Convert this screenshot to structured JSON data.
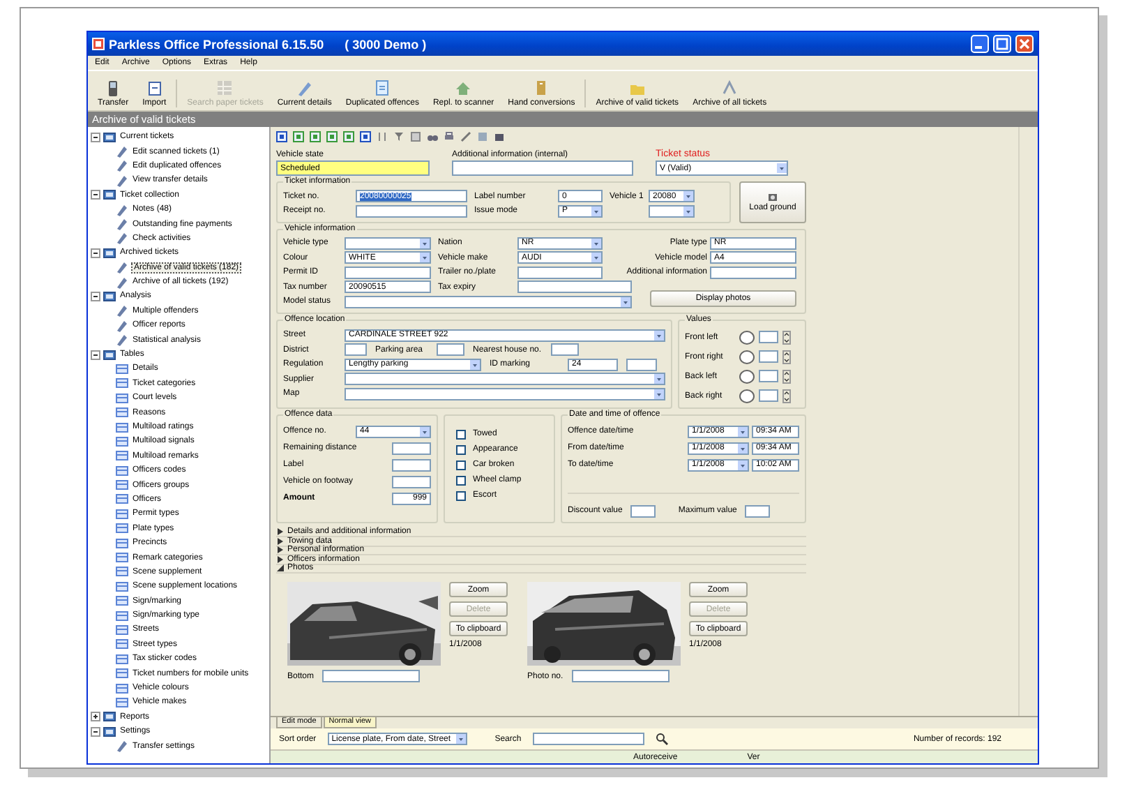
{
  "window": {
    "title": "Parkless Office Professional 6.15.50",
    "edition": "( 3000 Demo )"
  },
  "menu": [
    "Edit",
    "Archive",
    "Options",
    "Extras",
    "Help"
  ],
  "toolbar": [
    {
      "label": "Transfer",
      "disabled": false
    },
    {
      "label": "Import",
      "disabled": false
    },
    {
      "label": "Search paper tickets",
      "disabled": true
    },
    {
      "label": "Current details",
      "disabled": false
    },
    {
      "label": "Duplicated offences",
      "disabled": false
    },
    {
      "label": "Repl. to scanner",
      "disabled": false
    },
    {
      "label": "Hand conversions",
      "disabled": false
    },
    {
      "label": "Archive of valid tickets",
      "disabled": false
    },
    {
      "label": "Archive of all tickets",
      "disabled": false
    }
  ],
  "view_header": "Archive of valid tickets",
  "tree": [
    {
      "label": "Current tickets",
      "expanded": true,
      "selected": false,
      "children": [
        {
          "label": "Edit scanned tickets (1)",
          "selected": false
        },
        {
          "label": "Edit duplicated offences",
          "selected": false
        },
        {
          "label": "View transfer details",
          "selected": false
        }
      ]
    },
    {
      "label": "Ticket collection",
      "expanded": true,
      "selected": false,
      "children": [
        {
          "label": "Notes (48)",
          "selected": false
        },
        {
          "label": "Outstanding fine payments",
          "selected": false
        },
        {
          "label": "Check activities",
          "selected": false
        }
      ]
    },
    {
      "label": "Archived tickets",
      "expanded": true,
      "selected": false,
      "children": [
        {
          "label": "Archive of valid tickets (182)",
          "selected": true
        },
        {
          "label": "Archive of all tickets (192)",
          "selected": false
        }
      ]
    },
    {
      "label": "Analysis",
      "expanded": true,
      "selected": false,
      "children": [
        {
          "label": "Multiple offenders",
          "selected": false
        },
        {
          "label": "Officer reports",
          "selected": false
        },
        {
          "label": "Statistical analysis",
          "selected": false
        }
      ]
    },
    {
      "label": "Tables",
      "expanded": true,
      "selected": false,
      "children": [
        {
          "label": "Details",
          "selected": false
        },
        {
          "label": "Ticket categories",
          "selected": false
        },
        {
          "label": "Court levels",
          "selected": false
        },
        {
          "label": "Reasons",
          "selected": false
        },
        {
          "label": "Multiload ratings",
          "selected": false
        },
        {
          "label": "Multiload signals",
          "selected": false
        },
        {
          "label": "Multiload remarks",
          "selected": false
        },
        {
          "label": "Officers codes",
          "selected": false
        },
        {
          "label": "Officers groups",
          "selected": false
        },
        {
          "label": "Officers",
          "selected": false
        },
        {
          "label": "Permit types",
          "selected": false
        },
        {
          "label": "Plate types",
          "selected": false
        },
        {
          "label": "Precincts",
          "selected": false
        },
        {
          "label": "Remark categories",
          "selected": false
        },
        {
          "label": "Scene supplement",
          "selected": false
        },
        {
          "label": "Scene supplement locations",
          "selected": false
        },
        {
          "label": "Sign/marking",
          "selected": false
        },
        {
          "label": "Sign/marking type",
          "selected": false
        },
        {
          "label": "Streets",
          "selected": false
        },
        {
          "label": "Street types",
          "selected": false
        },
        {
          "label": "Tax sticker codes",
          "selected": false
        },
        {
          "label": "Ticket numbers for mobile units",
          "selected": false
        },
        {
          "label": "Vehicle colours",
          "selected": false
        },
        {
          "label": "Vehicle makes",
          "selected": false
        }
      ]
    },
    {
      "label": "Reports",
      "expanded": false,
      "selected": false
    },
    {
      "label": "Settings",
      "expanded": true,
      "selected": false,
      "children": [
        {
          "label": "Transfer settings",
          "selected": false
        }
      ]
    }
  ],
  "form": {
    "top": [
      {
        "label": "Vehicle state",
        "kind": "text",
        "value": "Scheduled",
        "required": true
      },
      {
        "label": "Additional information (internal)",
        "kind": "text"
      },
      {
        "label": "Ticket status",
        "kind": "select",
        "value": "V (Valid)",
        "alert": true
      }
    ],
    "ticket_information": {
      "title": "Ticket information",
      "rows": [
        [
          {
            "label": "Ticket no.",
            "kind": "text",
            "value": "20080000025",
            "highlighted": true
          },
          {
            "label": "Label number",
            "kind": "text",
            "value": "0"
          },
          {
            "label": "Vehicle 1",
            "kind": "select",
            "value": "20080"
          }
        ],
        [
          {
            "label": "Receipt no.",
            "kind": "text"
          },
          {
            "label": "Issue mode",
            "kind": "select",
            "value": "P"
          },
          {
            "kind": "select"
          }
        ]
      ],
      "button": "Load ground"
    },
    "vehicle_information": {
      "title": "Vehicle information",
      "rows": [
        [
          {
            "label": "Vehicle type",
            "kind": "select"
          },
          {
            "label": "Nation",
            "kind": "select",
            "value": "NR"
          },
          {
            "label": "Plate type",
            "kind": "text",
            "value": "NR"
          }
        ],
        [
          {
            "label": "Colour",
            "kind": "select",
            "value": "WHITE"
          },
          {
            "label": "Vehicle make",
            "kind": "select",
            "value": "AUDI"
          },
          {
            "label": "Vehicle model",
            "kind": "text",
            "value": "A4"
          }
        ],
        [
          {
            "label": "Permit ID",
            "kind": "text"
          },
          {
            "label": "Trailer no./plate",
            "kind": "text"
          },
          {
            "label": "Additional information",
            "kind": "text"
          }
        ],
        [
          {
            "label": "Tax number",
            "kind": "text",
            "value": "20090515"
          },
          {
            "label": "Tax expiry",
            "kind": "text"
          }
        ],
        [
          {
            "label": "Model status",
            "kind": "select"
          }
        ]
      ],
      "button": "Display photos"
    },
    "offence_location": {
      "title": "Offence location",
      "fields": [
        {
          "label": "Street",
          "kind": "select",
          "value": "CARDINALE STREET 922"
        },
        {
          "label": "District",
          "kind": "text"
        },
        {
          "label": "Parking area",
          "kind": "text"
        },
        {
          "label": "Nearest house no.",
          "kind": "text"
        },
        {
          "label": "Regulation",
          "kind": "select",
          "value": "Lengthy parking"
        },
        {
          "label": "ID marking",
          "kind": "text",
          "value": "24"
        },
        {
          "kind": "text"
        },
        {
          "label": "Supplier",
          "kind": "select"
        },
        {
          "label": "Map",
          "kind": "select"
        }
      ]
    },
    "values": {
      "title": "Values",
      "rows": [
        {
          "label": "Front left"
        },
        {
          "label": "Front right"
        },
        {
          "label": "Back left"
        },
        {
          "label": "Back right"
        }
      ]
    },
    "offence_data": {
      "title": "Offence data",
      "rows": [
        {
          "label": "Offence no.",
          "kind": "select",
          "value": "44"
        },
        {
          "label": "Remaining distance",
          "kind": "text"
        },
        {
          "label": "Label",
          "kind": "text"
        },
        {
          "label": "Vehicle on footway",
          "kind": "text"
        },
        {
          "label": "Amount",
          "kind": "text",
          "value": "999"
        }
      ]
    },
    "options": [
      {
        "label": "Towed",
        "checked": false
      },
      {
        "label": "Appearance",
        "checked": false
      },
      {
        "label": "Car broken",
        "checked": false
      },
      {
        "label": "Wheel clamp",
        "checked": false
      },
      {
        "label": "Escort",
        "checked": false
      }
    ],
    "offence_time": {
      "title": "Date and time of offence",
      "rows": [
        {
          "label": "Offence date/time",
          "date": "1/1/2008",
          "time": "09:34 AM"
        },
        {
          "label": "From date/time",
          "date": "1/1/2008",
          "time": "09:34 AM"
        },
        {
          "label": "To date/time",
          "date": "1/1/2008",
          "time": "10:02 AM"
        }
      ],
      "limits": [
        {
          "label": "Discount value"
        },
        {
          "label": "Maximum value"
        }
      ]
    }
  },
  "sections": [
    {
      "label": "Details and additional information",
      "expanded": false
    },
    {
      "label": "Towing data",
      "expanded": false
    },
    {
      "label": "Personal information",
      "expanded": false
    },
    {
      "label": "Officers information",
      "expanded": false
    },
    {
      "label": "Photos",
      "expanded": true
    }
  ],
  "photos": [
    {
      "buttons": [
        {
          "label": "Zoom",
          "disabled": false
        },
        {
          "label": "Delete",
          "disabled": true
        },
        {
          "label": "To clipboard",
          "disabled": false
        }
      ],
      "caption": "1/1/2008",
      "field_label": "Bottom"
    },
    {
      "buttons": [
        {
          "label": "Zoom",
          "disabled": false
        },
        {
          "label": "Delete",
          "disabled": true
        },
        {
          "label": "To clipboard",
          "disabled": false
        }
      ],
      "caption": "1/1/2008",
      "field_label": "Photo no."
    }
  ],
  "tabs": [
    {
      "label": "Edit mode",
      "selected": false
    },
    {
      "label": "Normal view",
      "selected": true
    }
  ],
  "sort": {
    "label": "Sort order",
    "value": "License plate, From date, Street"
  },
  "search": {
    "label": "Search"
  },
  "records": "Number of records: 192",
  "status_bar": [
    "Autoreceive",
    "Ver"
  ]
}
